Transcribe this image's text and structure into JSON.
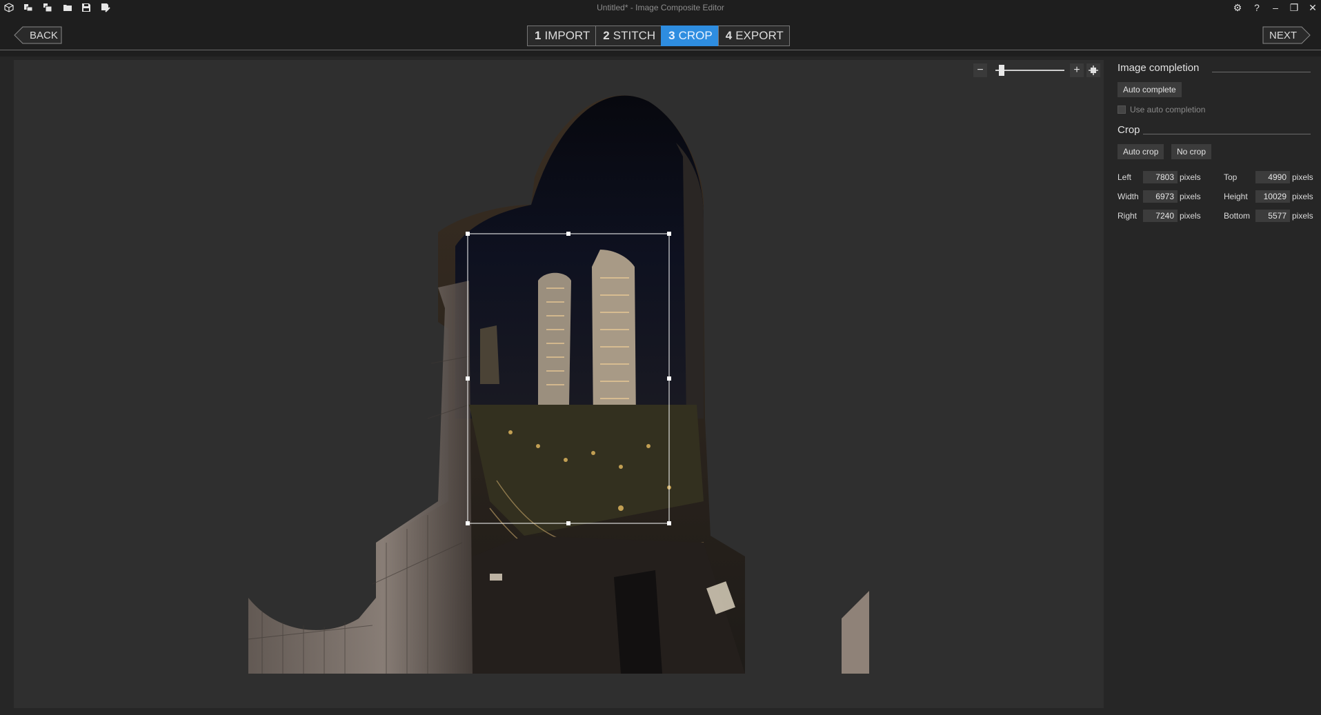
{
  "window": {
    "title": "Untitled* - Image Composite Editor",
    "toolbar_icons": [
      "new-project-icon",
      "new-panorama-from-images-icon",
      "new-panorama-from-video-icon",
      "open-project-icon",
      "save-project-icon",
      "save-as-icon"
    ],
    "controls": {
      "settings": "⚙",
      "help": "?",
      "minimize": "–",
      "restore": "❐",
      "close": "✕"
    }
  },
  "nav": {
    "back_label": "BACK",
    "next_label": "NEXT",
    "steps": [
      {
        "num": "1",
        "label": "IMPORT",
        "active": false
      },
      {
        "num": "2",
        "label": "STITCH",
        "active": false
      },
      {
        "num": "3",
        "label": "CROP",
        "active": true
      },
      {
        "num": "4",
        "label": "EXPORT",
        "active": false
      }
    ]
  },
  "zoom": {
    "minus": "−",
    "plus": "+",
    "level": 0.05
  },
  "panel": {
    "image_completion": {
      "title": "Image completion",
      "auto_complete_label": "Auto complete",
      "use_auto_completion_label": "Use auto completion",
      "use_auto_completion_checked": false
    },
    "crop": {
      "title": "Crop",
      "auto_crop_label": "Auto crop",
      "no_crop_label": "No crop",
      "unit": "pixels",
      "fields": {
        "left": {
          "label": "Left",
          "value": "7803"
        },
        "top": {
          "label": "Top",
          "value": "4990"
        },
        "width": {
          "label": "Width",
          "value": "6973"
        },
        "height": {
          "label": "Height",
          "value": "10029"
        },
        "right": {
          "label": "Right",
          "value": "7240"
        },
        "bottom": {
          "label": "Bottom",
          "value": "5577"
        }
      }
    }
  },
  "colors": {
    "accent": "#2e8de0",
    "background": "#262626",
    "canvas": "#2f2f2f"
  }
}
